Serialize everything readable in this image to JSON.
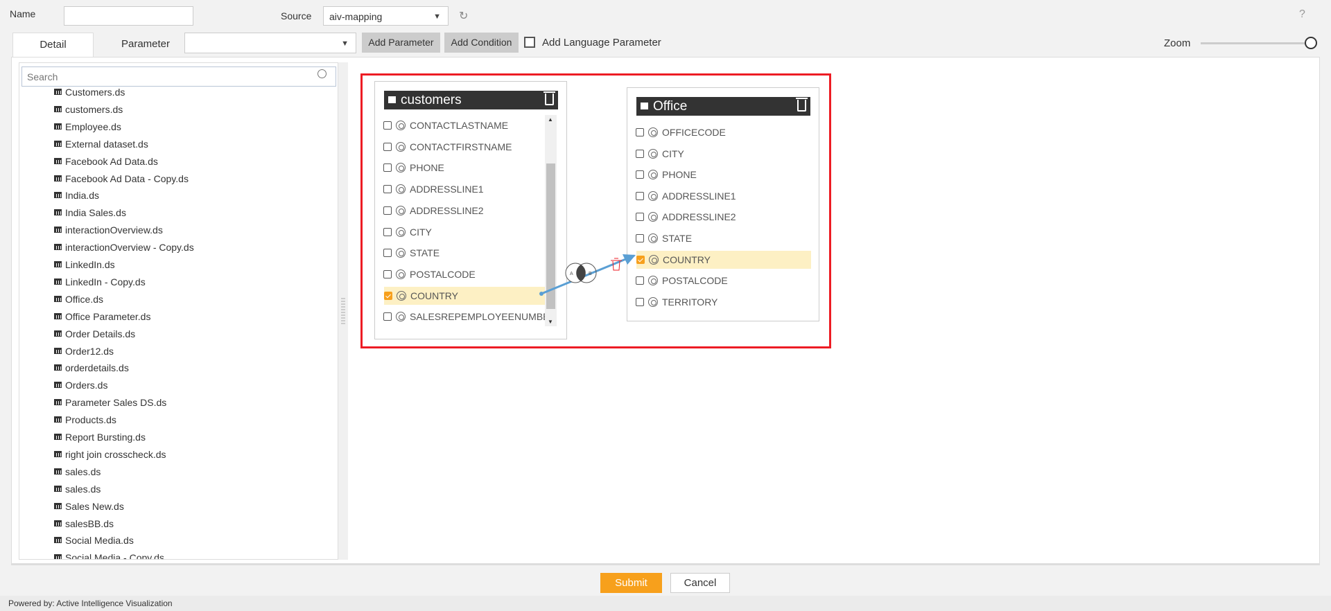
{
  "header": {
    "name_label": "Name",
    "name_value": "",
    "source_label": "Source",
    "source_value": "aiv-mapping",
    "help": "?"
  },
  "tabs": [
    {
      "label": "Detail",
      "active": true
    },
    {
      "label": "Parameter",
      "active": false
    }
  ],
  "toolbar": {
    "parameter_select": "",
    "add_parameter": "Add Parameter",
    "add_condition": "Add Condition",
    "add_language_parameter": "Add Language Parameter",
    "add_language_checked": false,
    "zoom_label": "Zoom",
    "zoom_level": 1.0
  },
  "sidebar": {
    "search_placeholder": "Search",
    "items": [
      "Customers.ds",
      "customers.ds",
      "Employee.ds",
      "External dataset.ds",
      "Facebook Ad Data.ds",
      "Facebook Ad Data - Copy.ds",
      "India.ds",
      "India Sales.ds",
      "interactionOverview.ds",
      "interactionOverview - Copy.ds",
      "LinkedIn.ds",
      "LinkedIn - Copy.ds",
      "Office.ds",
      "Office Parameter.ds",
      "Order Details.ds",
      "Order12.ds",
      "orderdetails.ds",
      "Orders.ds",
      "Parameter Sales DS.ds",
      "Products.ds",
      "Report Bursting.ds",
      "right join crosscheck.ds",
      "sales.ds",
      "sales.ds",
      "Sales New.ds",
      "salesBB.ds",
      "Social Media.ds",
      "Social Media - Copy.ds"
    ]
  },
  "canvas": {
    "tables": [
      {
        "title": "customers",
        "fields": [
          {
            "name": "CONTACTLASTNAME",
            "checked": false
          },
          {
            "name": "CONTACTFIRSTNAME",
            "checked": false
          },
          {
            "name": "PHONE",
            "checked": false
          },
          {
            "name": "ADDRESSLINE1",
            "checked": false
          },
          {
            "name": "ADDRESSLINE2",
            "checked": false
          },
          {
            "name": "CITY",
            "checked": false
          },
          {
            "name": "STATE",
            "checked": false
          },
          {
            "name": "POSTALCODE",
            "checked": false
          },
          {
            "name": "COUNTRY",
            "checked": true
          },
          {
            "name": "SALESREPEMPLOYEENUMBER",
            "checked": false
          }
        ]
      },
      {
        "title": "Office",
        "fields": [
          {
            "name": "OFFICECODE",
            "checked": false
          },
          {
            "name": "CITY",
            "checked": false
          },
          {
            "name": "PHONE",
            "checked": false
          },
          {
            "name": "ADDRESSLINE1",
            "checked": false
          },
          {
            "name": "ADDRESSLINE2",
            "checked": false
          },
          {
            "name": "STATE",
            "checked": false
          },
          {
            "name": "COUNTRY",
            "checked": true
          },
          {
            "name": "POSTALCODE",
            "checked": false
          },
          {
            "name": "TERRITORY",
            "checked": false
          }
        ]
      }
    ],
    "join": {
      "type": "inner",
      "left_label": "A",
      "right_label": "B",
      "from": "customers.COUNTRY",
      "to": "Office.COUNTRY"
    },
    "highlight_color": "#ed1c24"
  },
  "footer": {
    "submit": "Submit",
    "cancel": "Cancel",
    "powered_by": "Powered by: Active Intelligence Visualization"
  },
  "colors": {
    "accent": "#f7a01c",
    "header_dark": "#333333",
    "link_line": "#5a9fd4"
  }
}
